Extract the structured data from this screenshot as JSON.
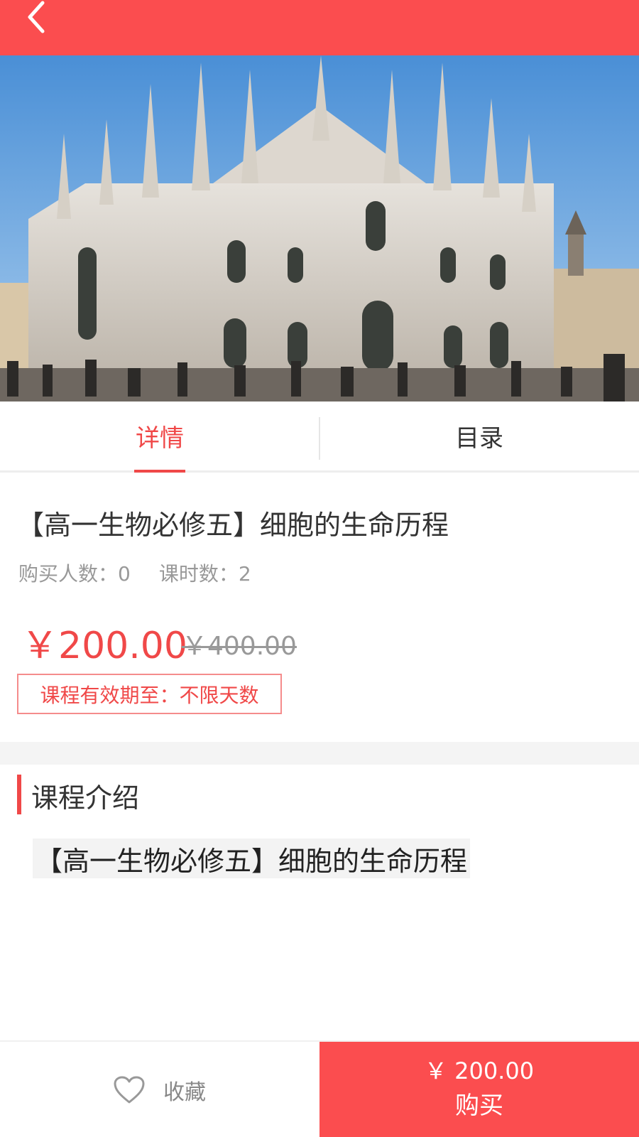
{
  "header": {
    "back_icon": "chevron-left-icon",
    "background_color": "#fb4d4f"
  },
  "hero": {
    "image": "cathedral-photo"
  },
  "tabs": [
    {
      "label": "详情",
      "active": true
    },
    {
      "label": "目录",
      "active": false
    }
  ],
  "course": {
    "title": "【高一生物必修五】细胞的生命历程",
    "buyers_label": "购买人数：0",
    "lessons_label": "课时数：2",
    "price_now": "￥200.00",
    "price_old": "￥400.00",
    "validity": "课程有效期至：不限天数"
  },
  "intro": {
    "heading": "课程介绍",
    "body": "【高一生物必修五】细胞的生命历程"
  },
  "bottom_bar": {
    "favorite_icon": "heart-outline-icon",
    "favorite_label": "收藏",
    "buy_price": "￥ 200.00",
    "buy_label": "购买"
  },
  "colors": {
    "accent": "#f04848",
    "bar": "#fb4d4f"
  }
}
